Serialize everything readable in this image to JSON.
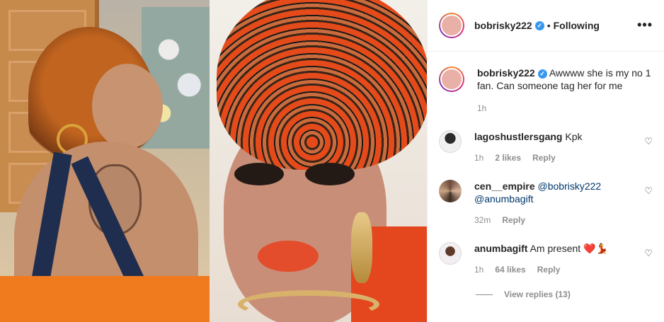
{
  "post": {
    "author": "bobrisky222",
    "follow_status": "Following",
    "more_icon": "more-horizontal-icon"
  },
  "caption": {
    "author": "bobrisky222",
    "text": "Awwww she is my no 1 fan. Can someone tag her for me",
    "time": "1h"
  },
  "comments": [
    {
      "author": "lagoshustlersgang",
      "text": "Kpk",
      "time": "1h",
      "likes": "2 likes",
      "reply": "Reply"
    },
    {
      "author": "cen__empire",
      "mention1": "@bobrisky222",
      "mention2": "@anumbagift",
      "time": "32m",
      "reply": "Reply"
    },
    {
      "author": "anumbagift",
      "text": "Am present ❤️💃",
      "time": "1h",
      "likes": "64 likes",
      "reply": "Reply"
    }
  ],
  "view_replies": "View replies (13)",
  "colors": {
    "verified": "#3897f0",
    "meta": "#8e8e8e",
    "link": "#00376b"
  }
}
